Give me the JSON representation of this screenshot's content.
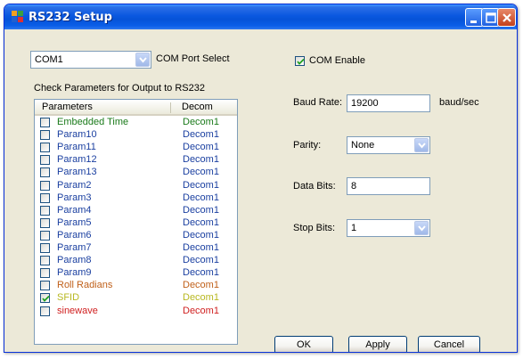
{
  "window": {
    "title": "RS232 Setup"
  },
  "port": {
    "selected": "COM1",
    "label": "COM Port Select"
  },
  "com_enable": {
    "label": "COM Enable",
    "checked": true
  },
  "params_caption": "Check Parameters for Output to RS232",
  "list": {
    "headers": [
      "Parameters",
      "Decom"
    ],
    "rows": [
      {
        "name": "Embedded Time",
        "decom": "Decom1",
        "checked": false,
        "color": "#1a7a1a"
      },
      {
        "name": "Param10",
        "decom": "Decom1",
        "checked": false,
        "color": "#1a3fa0"
      },
      {
        "name": "Param11",
        "decom": "Decom1",
        "checked": false,
        "color": "#1a3fa0"
      },
      {
        "name": "Param12",
        "decom": "Decom1",
        "checked": false,
        "color": "#1a3fa0"
      },
      {
        "name": "Param13",
        "decom": "Decom1",
        "checked": false,
        "color": "#1a3fa0"
      },
      {
        "name": "Param2",
        "decom": "Decom1",
        "checked": false,
        "color": "#1a3fa0"
      },
      {
        "name": "Param3",
        "decom": "Decom1",
        "checked": false,
        "color": "#1a3fa0"
      },
      {
        "name": "Param4",
        "decom": "Decom1",
        "checked": false,
        "color": "#1a3fa0"
      },
      {
        "name": "Param5",
        "decom": "Decom1",
        "checked": false,
        "color": "#1a3fa0"
      },
      {
        "name": "Param6",
        "decom": "Decom1",
        "checked": false,
        "color": "#1a3fa0"
      },
      {
        "name": "Param7",
        "decom": "Decom1",
        "checked": false,
        "color": "#1a3fa0"
      },
      {
        "name": "Param8",
        "decom": "Decom1",
        "checked": false,
        "color": "#1a3fa0"
      },
      {
        "name": "Param9",
        "decom": "Decom1",
        "checked": false,
        "color": "#1a3fa0"
      },
      {
        "name": "Roll Radians",
        "decom": "Decom1",
        "checked": false,
        "color": "#c0601a"
      },
      {
        "name": "SFID",
        "decom": "Decom1",
        "checked": true,
        "color": "#b8b820"
      },
      {
        "name": "sinewave",
        "decom": "Decom1",
        "checked": false,
        "color": "#d02020"
      }
    ]
  },
  "settings": {
    "baud_label": "Baud Rate:",
    "baud_value": "19200",
    "baud_unit": "baud/sec",
    "parity_label": "Parity:",
    "parity_value": "None",
    "databits_label": "Data Bits:",
    "databits_value": "8",
    "stopbits_label": "Stop Bits:",
    "stopbits_value": "1"
  },
  "buttons": {
    "ok": "OK",
    "apply": "Apply",
    "cancel": "Cancel"
  },
  "icons": {
    "app": "app-window-icon",
    "minimize": "minimize-icon",
    "maximize": "maximize-icon",
    "close": "close-icon",
    "dropdown": "chevron-down-icon",
    "check": "checkmark-icon"
  }
}
